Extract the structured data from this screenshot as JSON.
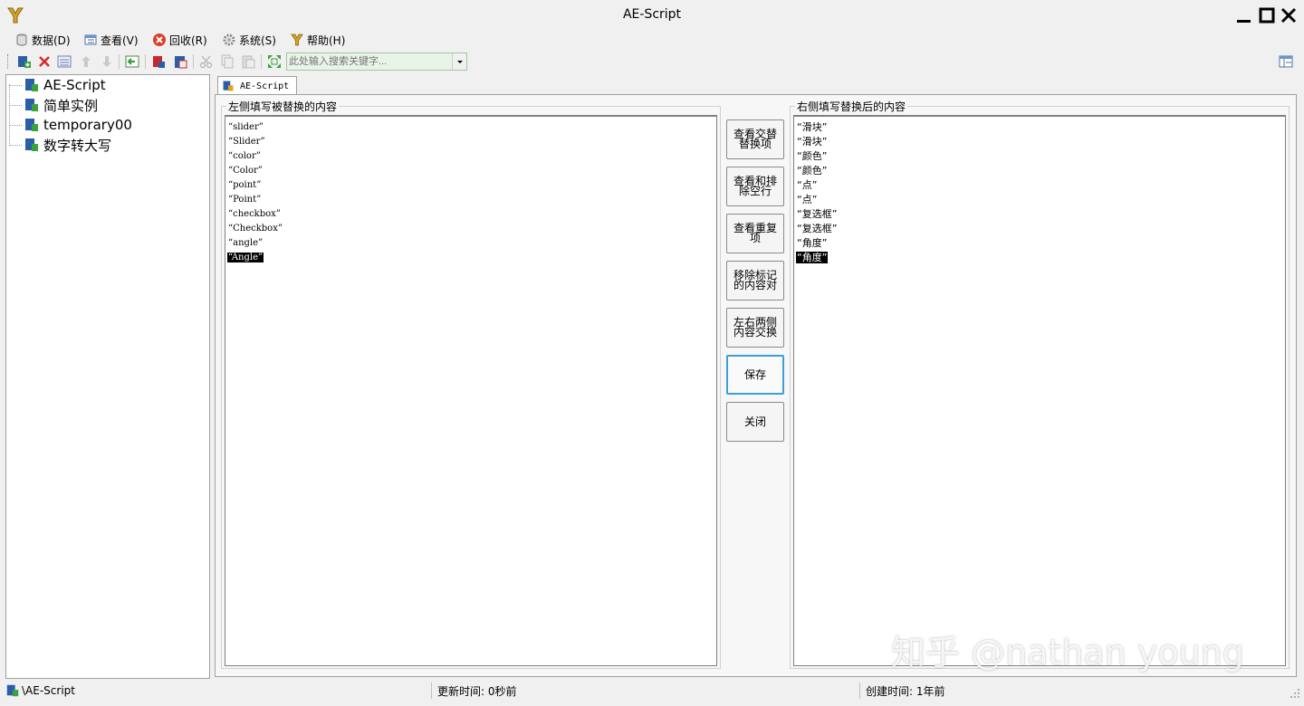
{
  "window": {
    "title": "AE-Script"
  },
  "menu": {
    "items": [
      {
        "label": "数据(D)",
        "icon": "database-icon"
      },
      {
        "label": "查看(V)",
        "icon": "view-icon"
      },
      {
        "label": "回收(R)",
        "icon": "recycle-icon"
      },
      {
        "label": "系统(S)",
        "icon": "gear-icon"
      },
      {
        "label": "帮助(H)",
        "icon": "help-icon"
      }
    ]
  },
  "toolbar": {
    "search_placeholder": "此处输入搜索关键字..."
  },
  "tree": {
    "items": [
      "AE-Script",
      "简单实例",
      "temporary00",
      "数字转大写"
    ]
  },
  "tab": {
    "label": "AE-Script"
  },
  "left_group": {
    "label": "左侧填写被替换的内容",
    "lines": [
      "“slider”",
      "“Slider”",
      "“color”",
      "“Color”",
      "“point”",
      "“Point”",
      "“checkbox”",
      "“Checkbox”",
      "“angle”",
      "“Angle”"
    ],
    "selected_index": 9
  },
  "right_group": {
    "label": "右侧填写替换后的内容",
    "lines": [
      "“滑块”",
      "“滑块”",
      "“颜色”",
      "“颜色”",
      "“点”",
      "“点”",
      "“复选框”",
      "“复选框”",
      "“角度”",
      "“角度”"
    ],
    "selected_index": 9
  },
  "buttons": {
    "view_alternate": "查看交替替换项",
    "view_sort": "查看和排除空行",
    "view_duplicates": "查看重复项",
    "remove_marked": "移除标记的内容对",
    "swap_sides": "左右两侧内容交换",
    "save": "保存",
    "close": "关闭"
  },
  "status": {
    "path": "\\AE-Script",
    "updated": "更新时间: 0秒前",
    "created": "创建时间: 1年前"
  },
  "watermark": "知乎 @nathan young",
  "colors": {
    "accent": "#3c9fd8",
    "selection": "#000000"
  }
}
